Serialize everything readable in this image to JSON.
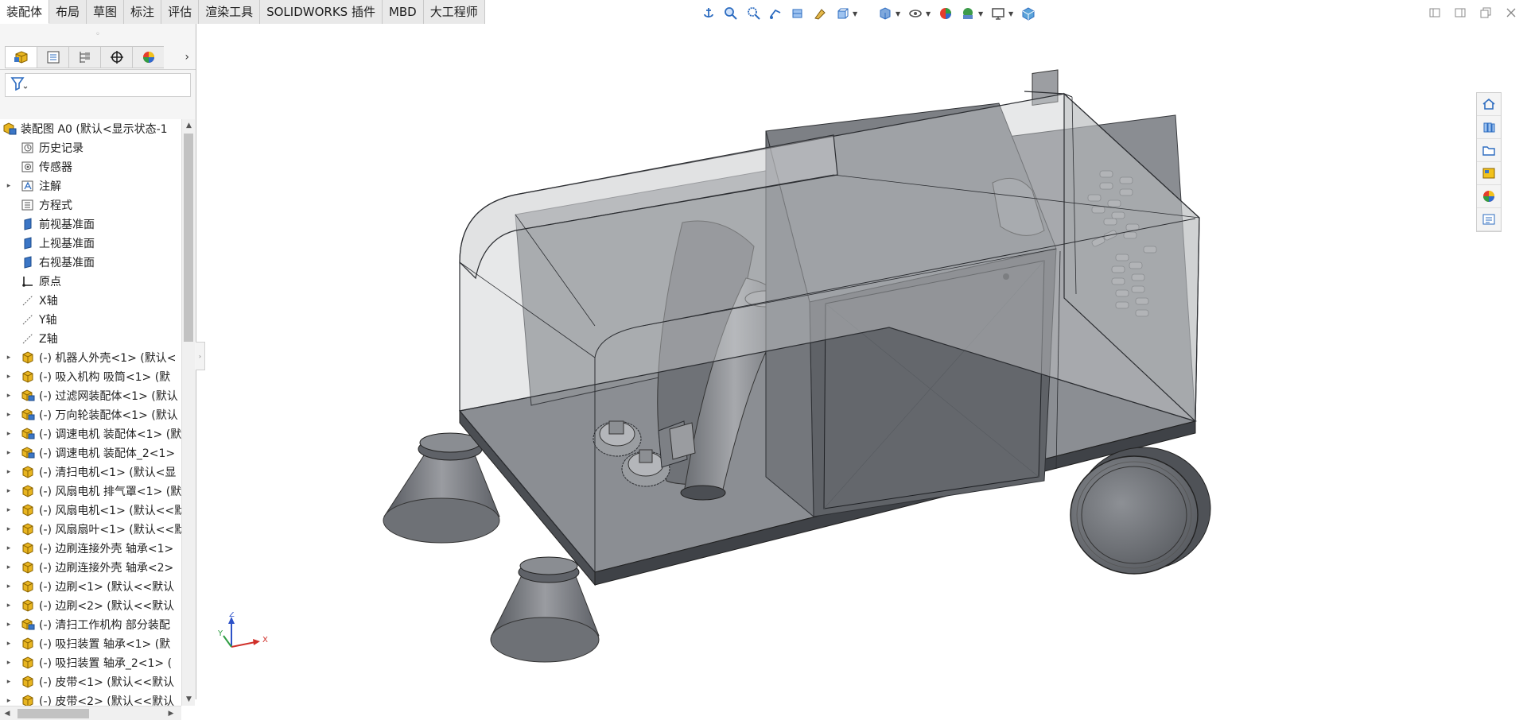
{
  "command_tabs": [
    {
      "label": "装配体",
      "active": true
    },
    {
      "label": "布局"
    },
    {
      "label": "草图"
    },
    {
      "label": "标注"
    },
    {
      "label": "评估"
    },
    {
      "label": "渲染工具"
    },
    {
      "label": "SOLIDWORKS 插件"
    },
    {
      "label": "MBD"
    },
    {
      "label": "大工程师"
    }
  ],
  "view_toolbar": [
    "anchor-icon",
    "zoom-to-fit-icon",
    "zoom-area-icon",
    "previous-view-icon",
    "section-view-icon",
    "dynamic-annotation-icon",
    "view-orientation-icon",
    "display-style-icon",
    "hide-show-icon",
    "edit-appearance-icon",
    "apply-scene-icon",
    "view-settings-icon",
    "3d-view-icon"
  ],
  "feature_tree": {
    "root": "装配图 A0  (默认<显示状态-1",
    "items": [
      {
        "label": "历史记录",
        "icon": "history-icon",
        "expand": false
      },
      {
        "label": "传感器",
        "icon": "sensor-icon",
        "expand": false
      },
      {
        "label": "注解",
        "icon": "annotation-icon",
        "expand": true
      },
      {
        "label": "方程式",
        "icon": "equation-icon",
        "expand": false
      },
      {
        "label": "前视基准面",
        "icon": "plane-icon",
        "expand": false
      },
      {
        "label": "上视基准面",
        "icon": "plane-icon",
        "expand": false
      },
      {
        "label": "右视基准面",
        "icon": "plane-icon",
        "expand": false
      },
      {
        "label": "原点",
        "icon": "origin-icon",
        "expand": false
      },
      {
        "label": "X轴",
        "icon": "axis-icon",
        "expand": false
      },
      {
        "label": "Y轴",
        "icon": "axis-icon",
        "expand": false
      },
      {
        "label": "Z轴",
        "icon": "axis-icon",
        "expand": false
      },
      {
        "label": "(-) 机器人外壳<1> (默认<",
        "icon": "part-icon",
        "expand": true
      },
      {
        "label": "(-) 吸入机构   吸筒<1> (默",
        "icon": "part-icon",
        "expand": true
      },
      {
        "label": "(-) 过滤网装配体<1> (默认",
        "icon": "subassembly-icon",
        "expand": true
      },
      {
        "label": "(-) 万向轮装配体<1> (默认",
        "icon": "subassembly-icon",
        "expand": true
      },
      {
        "label": "(-) 调速电机 装配体<1> (默",
        "icon": "subassembly-icon",
        "expand": true
      },
      {
        "label": "(-) 调速电机 装配体_2<1>",
        "icon": "subassembly-icon",
        "expand": true
      },
      {
        "label": "(-) 清扫电机<1> (默认<显",
        "icon": "part-icon",
        "expand": true
      },
      {
        "label": "(-) 风扇电机 排气罩<1> (默",
        "icon": "part-icon",
        "expand": true
      },
      {
        "label": "(-) 风扇电机<1> (默认<<默",
        "icon": "part-icon",
        "expand": true
      },
      {
        "label": "(-) 风扇扇叶<1> (默认<<默",
        "icon": "part-icon",
        "expand": true
      },
      {
        "label": "(-) 边刷连接外壳 轴承<1>",
        "icon": "part-icon",
        "expand": true
      },
      {
        "label": "(-) 边刷连接外壳 轴承<2>",
        "icon": "part-icon",
        "expand": true
      },
      {
        "label": "(-) 边刷<1> (默认<<默认",
        "icon": "part-icon",
        "expand": true
      },
      {
        "label": "(-) 边刷<2> (默认<<默认",
        "icon": "part-icon",
        "expand": true
      },
      {
        "label": "(-) 清扫工作机构 部分装配",
        "icon": "subassembly-icon",
        "expand": true
      },
      {
        "label": "(-) 吸扫装置  轴承<1> (默",
        "icon": "part-icon",
        "expand": true
      },
      {
        "label": "(-) 吸扫装置  轴承_2<1> (",
        "icon": "part-icon",
        "expand": true
      },
      {
        "label": "(-) 皮带<1> (默认<<默认",
        "icon": "part-icon",
        "expand": true
      },
      {
        "label": "(-) 皮带<2> (默认<<默认",
        "icon": "part-icon",
        "expand": true
      }
    ]
  },
  "task_pane": [
    "home-icon",
    "design-library-icon",
    "file-explorer-icon",
    "view-palette-icon",
    "appearances-icon",
    "custom-properties-icon"
  ],
  "triad": {
    "x": "X",
    "y": "Y",
    "z": "Z"
  },
  "colors": {
    "accent": "#2a6ac8",
    "part_yellow": "#e8b521",
    "shell": "#b9babe"
  }
}
